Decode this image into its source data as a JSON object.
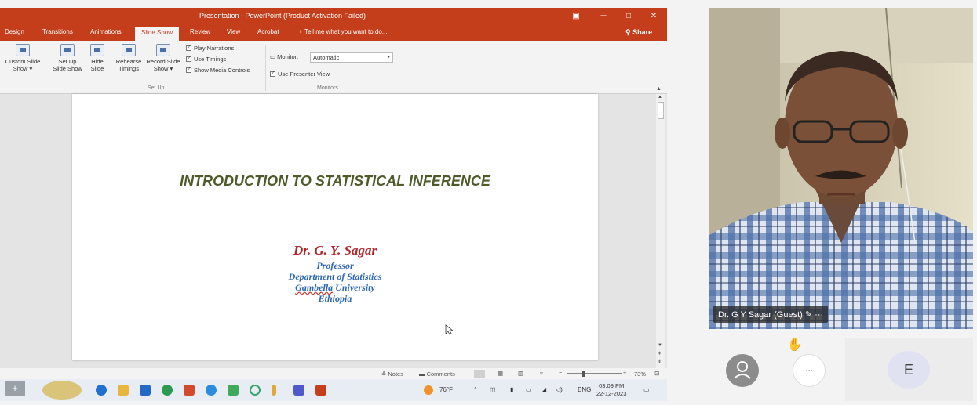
{
  "window": {
    "title": "Presentation - PowerPoint (Product Activation Failed)",
    "min": "─",
    "max": "□",
    "close": "✕",
    "restore": "▣"
  },
  "tabs": [
    "Design",
    "Transitions",
    "Animations",
    "Slide Show",
    "Review",
    "View",
    "Acrobat"
  ],
  "tellme": "Tell me what you want to do...",
  "share": "Share",
  "ribbon": {
    "custom_slide_show": [
      "Custom Slide",
      "Show ▾"
    ],
    "set_up": [
      "Set Up",
      "Slide Show"
    ],
    "hide": [
      "Hide",
      "Slide"
    ],
    "rehearse": [
      "Rehearse",
      "Timings"
    ],
    "record": [
      "Record Slide",
      "Show ▾"
    ],
    "play_narrations": "Play Narrations",
    "use_timings": "Use Timings",
    "show_media_controls": "Show Media Controls",
    "group_setup": "Set Up",
    "monitor_label": "Monitor:",
    "monitor_value": "Automatic",
    "use_presenter_view": "Use Presenter View",
    "group_monitors": "Monitors"
  },
  "slide": {
    "title": "INTRODUCTION TO STATISTICAL INFERENCE",
    "name": "Dr. G. Y. Sagar",
    "role": "Professor",
    "dept": "Department of Statistics",
    "univ_1": "Gambella",
    "univ_2": "University",
    "country": "Ethiopia"
  },
  "status": {
    "notes": "Notes",
    "comments": "Comments",
    "zoom": "73%"
  },
  "taskbar": {
    "weather": "76°F",
    "lang": "ENG",
    "time": "03:09 PM",
    "date": "22-12-2023"
  },
  "participant": {
    "name": "Dr. G Y Sagar (Guest)",
    "more": "···",
    "initial": "E"
  },
  "colors": {
    "ppt_accent": "#c43e1c",
    "title_green": "#4e5a2a",
    "name_red": "#b0242a",
    "blue_text": "#2b65b4"
  }
}
